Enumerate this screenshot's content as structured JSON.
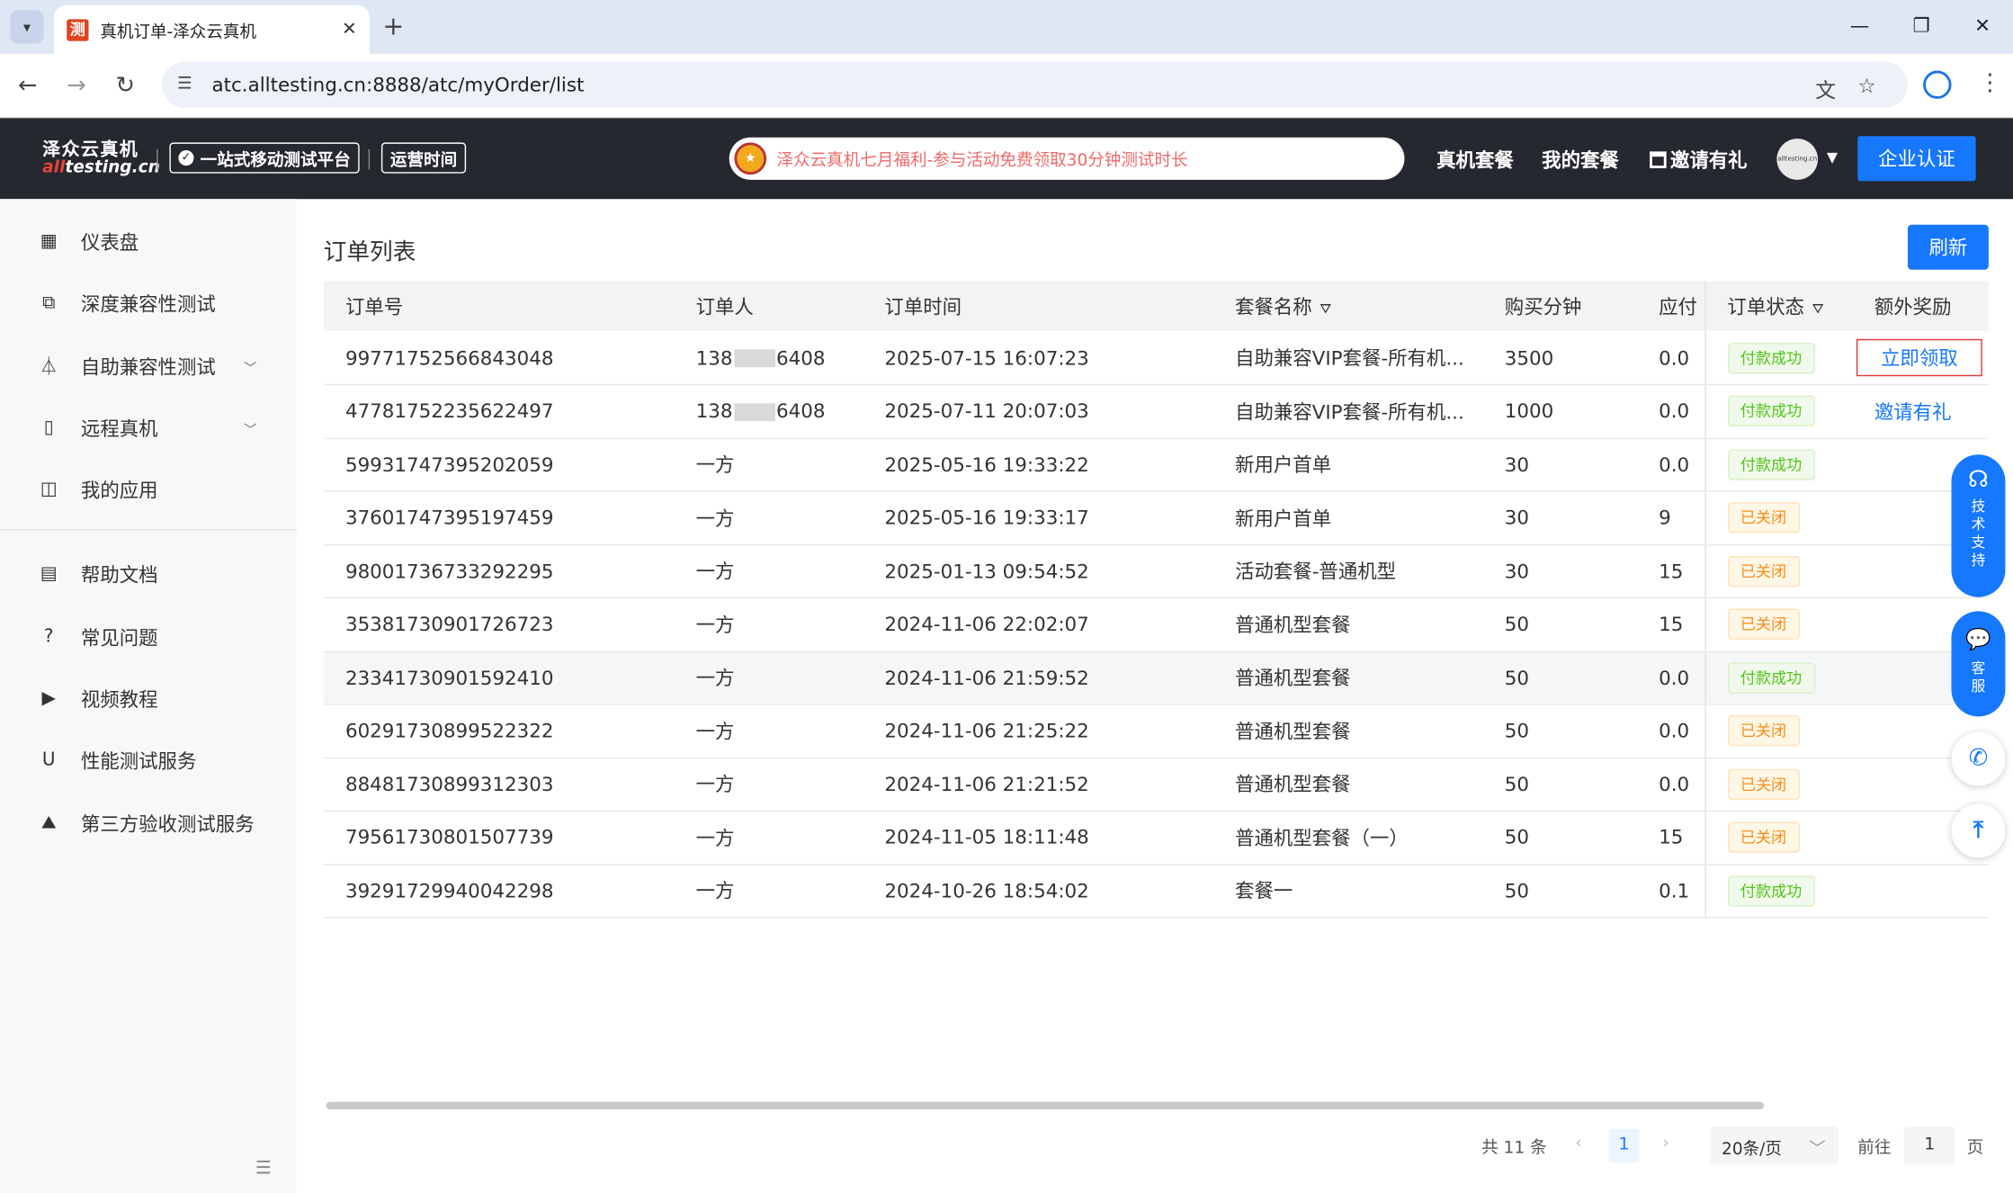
{
  "browser": {
    "tab_title": "真机订单-泽众云真机",
    "url": "atc.alltesting.cn:8888/atc/myOrder/list",
    "favicon_text": "测"
  },
  "header": {
    "logo_cn": "泽众云真机",
    "logo_en_red": "all",
    "logo_en_rest": "testing.cn",
    "badge_platform": "一站式移动测试平台",
    "badge_hours": "运营时间",
    "notice": "泽众云真机七月福利-参与活动免费领取30分钟测试时长",
    "nav": [
      "真机套餐",
      "我的套餐",
      "邀请有礼"
    ],
    "avatar_text": "alltesting.cn",
    "cert_button": "企业认证"
  },
  "sidebar": {
    "items": [
      {
        "label": "仪表盘",
        "icon": "dashboard-icon"
      },
      {
        "label": "深度兼容性测试",
        "icon": "copy-icon"
      },
      {
        "label": "自助兼容性测试",
        "icon": "flask-icon"
      },
      {
        "label": "远程真机",
        "icon": "device-icon"
      },
      {
        "label": "我的应用",
        "icon": "app-icon"
      },
      {
        "label": "帮助文档",
        "icon": "book-icon"
      },
      {
        "label": "常见问题",
        "icon": "question-icon"
      },
      {
        "label": "视频教程",
        "icon": "video-icon"
      },
      {
        "label": "性能测试服务",
        "icon": "magnet-icon"
      },
      {
        "label": "第三方验收测试服务",
        "icon": "chart-icon"
      }
    ]
  },
  "main": {
    "title": "订单列表",
    "refresh": "刷新",
    "columns": [
      "订单号",
      "订单人",
      "订单时间",
      "套餐名称",
      "购买分钟",
      "应付",
      "订单状态",
      "额外奖励"
    ],
    "rows": [
      {
        "id": "99771752566843048",
        "user_a": "138",
        "user_b": "6408",
        "masked": true,
        "time": "2025-07-15 16:07:23",
        "pkg": "自助兼容VIP套餐-所有机...",
        "mins": "3500",
        "pay": "0.0",
        "status": "付款成功",
        "ok": true,
        "reward": "立即领取"
      },
      {
        "id": "47781752235622497",
        "user_a": "138",
        "user_b": "6408",
        "masked": true,
        "time": "2025-07-11 20:07:03",
        "pkg": "自助兼容VIP套餐-所有机...",
        "mins": "1000",
        "pay": "0.0",
        "status": "付款成功",
        "ok": true,
        "reward": "邀请有礼"
      },
      {
        "id": "59931747395202059",
        "user_a": "一方",
        "user_b": "",
        "masked": false,
        "time": "2025-05-16 19:33:22",
        "pkg": "新用户首单",
        "mins": "30",
        "pay": "0.0",
        "status": "付款成功",
        "ok": true,
        "reward": ""
      },
      {
        "id": "37601747395197459",
        "user_a": "一方",
        "user_b": "",
        "masked": false,
        "time": "2025-05-16 19:33:17",
        "pkg": "新用户首单",
        "mins": "30",
        "pay": "9",
        "status": "已关闭",
        "ok": false,
        "reward": ""
      },
      {
        "id": "98001736733292295",
        "user_a": "一方",
        "user_b": "",
        "masked": false,
        "time": "2025-01-13 09:54:52",
        "pkg": "活动套餐-普通机型",
        "mins": "30",
        "pay": "15",
        "status": "已关闭",
        "ok": false,
        "reward": ""
      },
      {
        "id": "35381730901726723",
        "user_a": "一方",
        "user_b": "",
        "masked": false,
        "time": "2024-11-06 22:02:07",
        "pkg": "普通机型套餐",
        "mins": "50",
        "pay": "15",
        "status": "已关闭",
        "ok": false,
        "reward": ""
      },
      {
        "id": "23341730901592410",
        "user_a": "一方",
        "user_b": "",
        "masked": false,
        "time": "2024-11-06 21:59:52",
        "pkg": "普通机型套餐",
        "mins": "50",
        "pay": "0.0",
        "status": "付款成功",
        "ok": true,
        "reward": ""
      },
      {
        "id": "60291730899522322",
        "user_a": "一方",
        "user_b": "",
        "masked": false,
        "time": "2024-11-06 21:25:22",
        "pkg": "普通机型套餐",
        "mins": "50",
        "pay": "0.0",
        "status": "已关闭",
        "ok": false,
        "reward": ""
      },
      {
        "id": "88481730899312303",
        "user_a": "一方",
        "user_b": "",
        "masked": false,
        "time": "2024-11-06 21:21:52",
        "pkg": "普通机型套餐",
        "mins": "50",
        "pay": "0.0",
        "status": "已关闭",
        "ok": false,
        "reward": ""
      },
      {
        "id": "79561730801507739",
        "user_a": "一方",
        "user_b": "",
        "masked": false,
        "time": "2024-11-05 18:11:48",
        "pkg": "普通机型套餐（一）",
        "mins": "50",
        "pay": "15",
        "status": "已关闭",
        "ok": false,
        "reward": ""
      },
      {
        "id": "39291729940042298",
        "user_a": "一方",
        "user_b": "",
        "masked": false,
        "time": "2024-10-26 18:54:02",
        "pkg": "套餐一",
        "mins": "50",
        "pay": "0.1",
        "status": "付款成功",
        "ok": true,
        "reward": ""
      }
    ]
  },
  "pager": {
    "total": "共 11 条",
    "current": "1",
    "page_size": "20条/页",
    "goto_label": "前往",
    "goto_value": "1",
    "page_unit": "页"
  },
  "float": {
    "support": "技术支持",
    "service": "客服"
  },
  "colors": {
    "primary": "#1677ff",
    "success": "#52c41a",
    "closed": "#fa8c16",
    "header_bg": "#26282f"
  }
}
